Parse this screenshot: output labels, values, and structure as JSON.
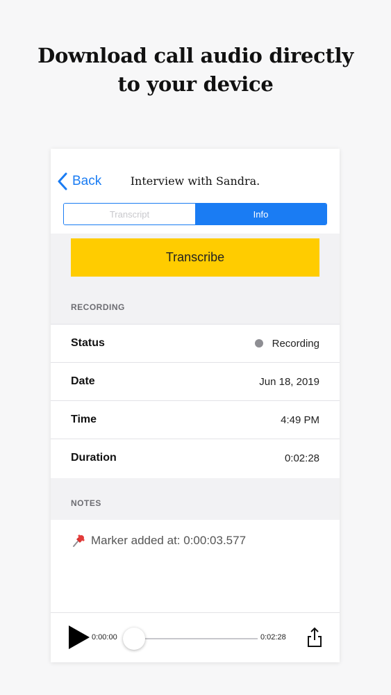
{
  "headline": {
    "line1": "Download call audio directly",
    "line2": "to your device"
  },
  "nav": {
    "back_label": "Back",
    "title": "Interview with Sandra."
  },
  "tabs": [
    {
      "label": "Transcript",
      "selected": false
    },
    {
      "label": "Info",
      "selected": true
    }
  ],
  "transcribe_label": "Transcribe",
  "recording_section": {
    "header": "RECORDING",
    "rows": [
      {
        "label": "Status",
        "value": "Recording"
      },
      {
        "label": "Date",
        "value": "Jun 18, 2019"
      },
      {
        "label": "Time",
        "value": "4:49 PM"
      },
      {
        "label": "Duration",
        "value": "0:02:28"
      }
    ]
  },
  "notes_section": {
    "header": "NOTES",
    "note_text": "Marker added at: 0:00:03.577"
  },
  "player": {
    "current_time": "0:00:00",
    "total_time": "0:02:28",
    "progress": 0
  },
  "colors": {
    "accent": "#1a7cf3",
    "transcribe_button": "#ffcc00",
    "status_dot": "#8e8e93"
  },
  "icons": {
    "back": "chevron-left-icon",
    "status": "status-dot-icon",
    "note": "pushpin-icon",
    "play": "play-icon",
    "share": "share-icon"
  }
}
